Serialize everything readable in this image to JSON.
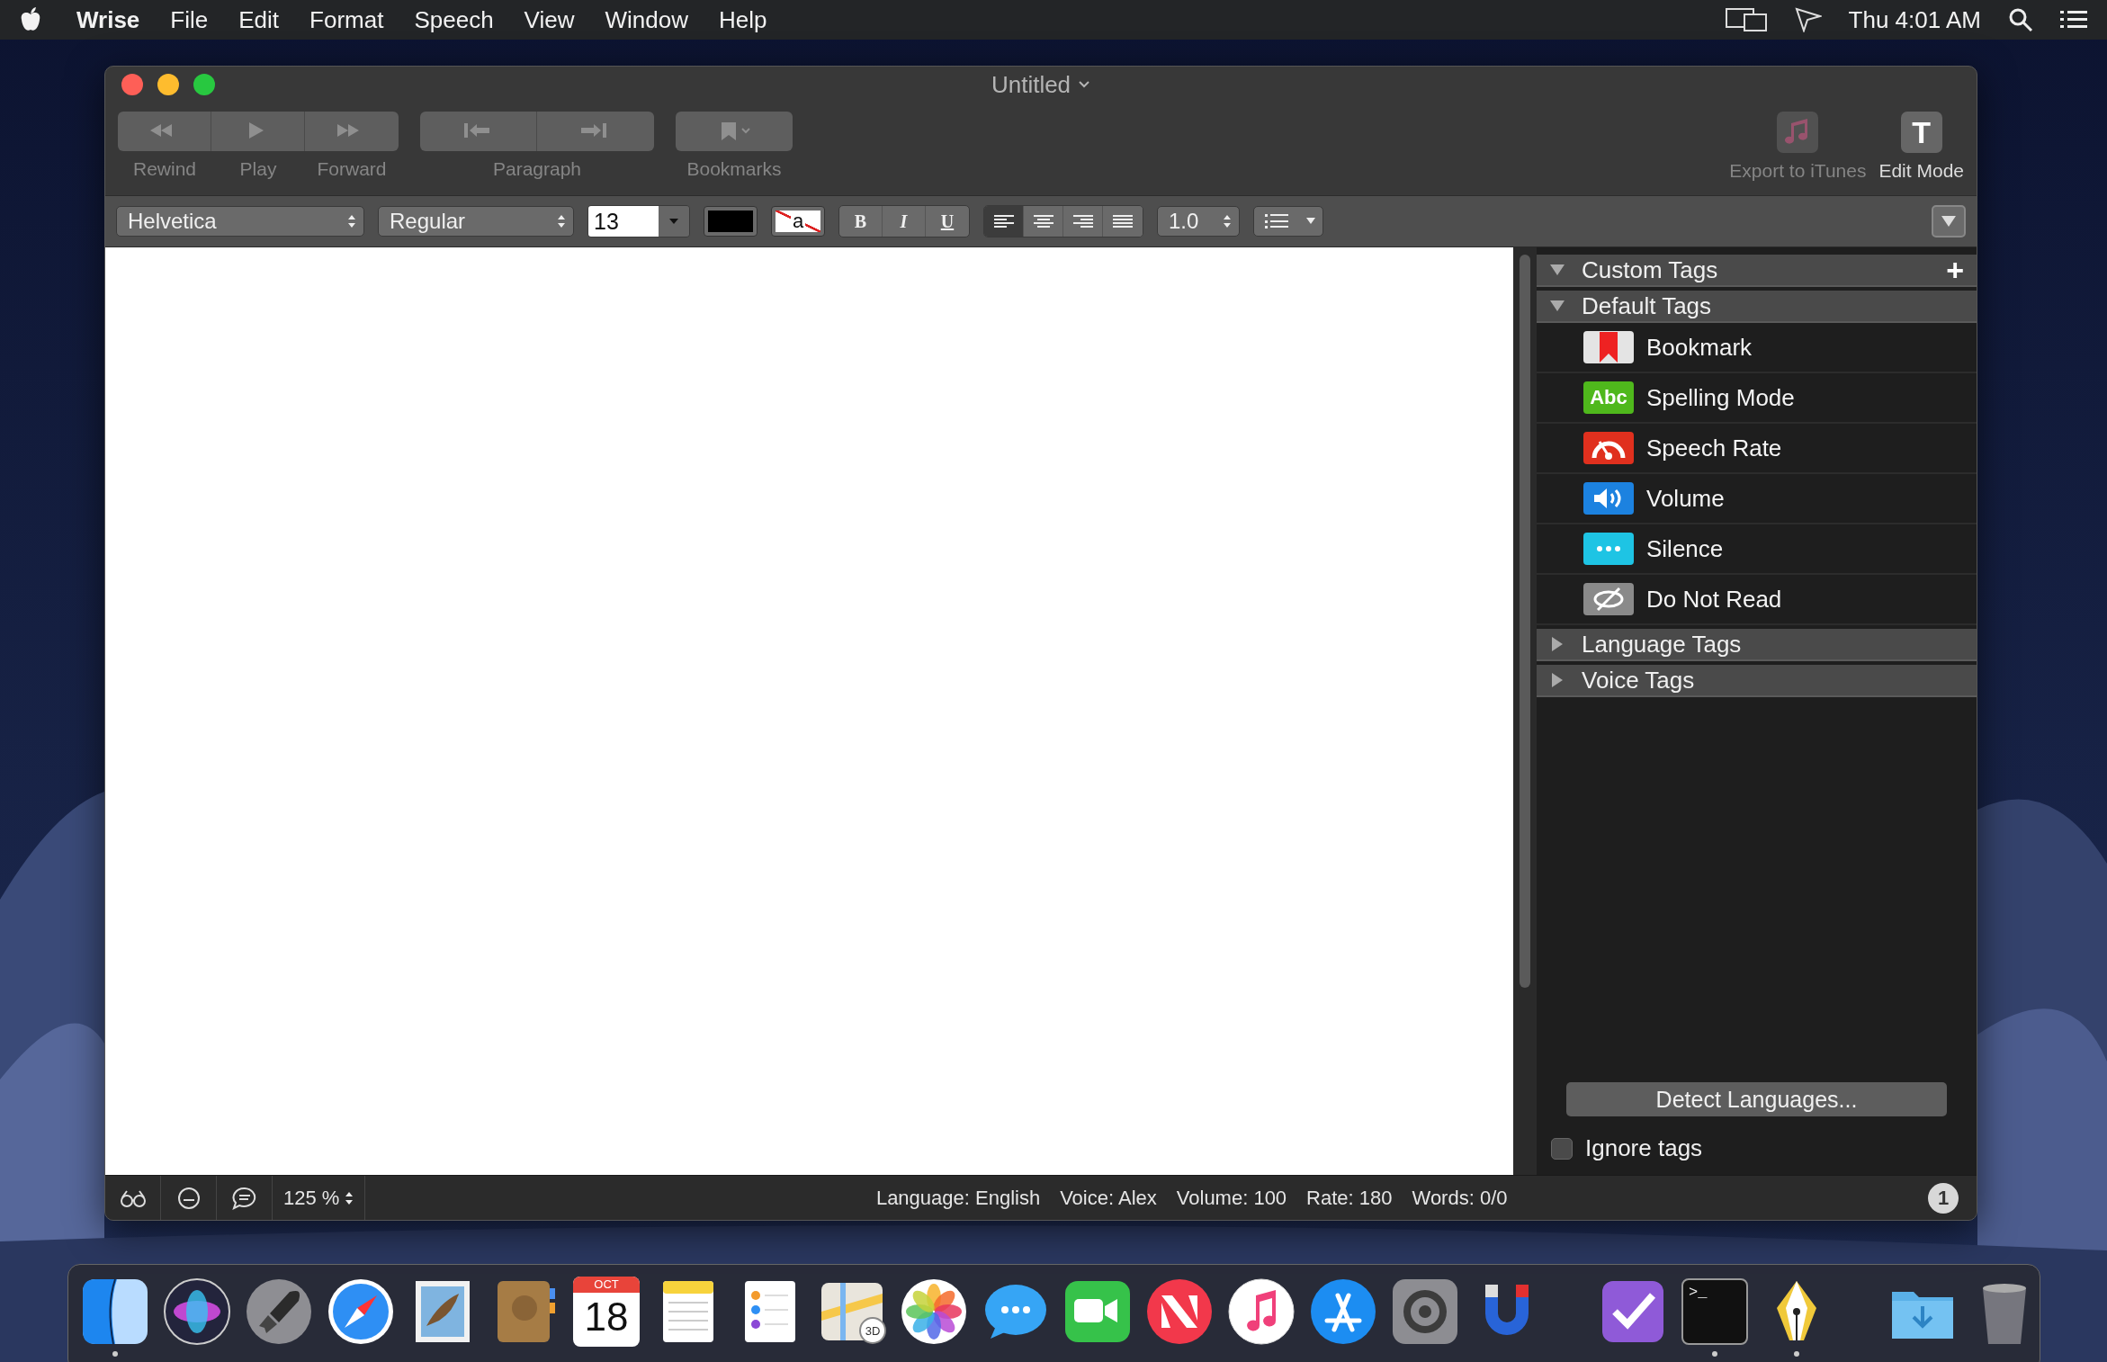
{
  "menubar": {
    "app_name": "Wrise",
    "menus": [
      "File",
      "Edit",
      "Format",
      "Speech",
      "View",
      "Window",
      "Help"
    ],
    "clock": "Thu 4:01 AM"
  },
  "window": {
    "title": "Untitled"
  },
  "toolbar": {
    "groups": [
      {
        "disabled": true,
        "segments": [
          {
            "kind": "rewind",
            "label": "Rewind"
          },
          {
            "kind": "play",
            "label": "Play"
          },
          {
            "kind": "forward",
            "label": "Forward"
          }
        ]
      },
      {
        "disabled": true,
        "label": "Paragraph",
        "segments": [
          {
            "kind": "previous"
          },
          {
            "kind": "next"
          }
        ]
      },
      {
        "disabled": true,
        "label": "Bookmarks",
        "segments": [
          {
            "kind": "bookmarks"
          }
        ]
      }
    ],
    "right_items": [
      {
        "kind": "music",
        "label": "Export to iTunes",
        "disabled": true
      },
      {
        "kind": "letter",
        "letter": "T",
        "label": "Edit Mode",
        "disabled": false
      }
    ]
  },
  "format_bar": {
    "font": "Helvetica",
    "style": "Regular",
    "size": "13",
    "highlight_sample": "a",
    "styles": [
      {
        "kind": "bold",
        "text": "B"
      },
      {
        "kind": "italic",
        "text": "I"
      },
      {
        "kind": "underline",
        "text": "U"
      }
    ],
    "alignment": [
      {
        "kind": "left",
        "selected": true
      },
      {
        "kind": "center",
        "selected": false
      },
      {
        "kind": "right",
        "selected": false
      },
      {
        "kind": "justify",
        "selected": false
      }
    ],
    "line_spacing": "1.0"
  },
  "sidebar": {
    "sections": [
      {
        "title": "Custom Tags",
        "expanded": true,
        "action": "+"
      },
      {
        "title": "Default Tags",
        "expanded": true,
        "children": [
          {
            "kind": "bookmark",
            "label": "Bookmark"
          },
          {
            "kind": "spelling",
            "label": "Spelling Mode",
            "icon_text": "Abc"
          },
          {
            "kind": "rate",
            "label": "Speech Rate"
          },
          {
            "kind": "volume",
            "label": "Volume"
          },
          {
            "kind": "silence",
            "label": "Silence"
          },
          {
            "kind": "skip",
            "label": "Do Not Read"
          }
        ]
      },
      {
        "title": "Language Tags",
        "expanded": false
      },
      {
        "title": "Voice Tags",
        "expanded": false
      }
    ],
    "detect_button": "Detect Languages...",
    "ignore_tags": {
      "label": "Ignore tags",
      "checked": false
    }
  },
  "status_bar": {
    "zoom": "125 %",
    "items": [
      "Language: English",
      "Voice: Alex",
      "Volume: 100",
      "Rate: 180",
      "Words: 0/0"
    ],
    "badge": "1"
  },
  "dock": {
    "sections": [
      [
        {
          "kind": "finder",
          "running": true
        },
        {
          "kind": "siri",
          "running": false
        },
        {
          "kind": "launchpad",
          "running": false
        },
        {
          "kind": "safari",
          "running": false
        },
        {
          "kind": "mail",
          "running": false
        },
        {
          "kind": "contacts",
          "running": false
        },
        {
          "kind": "calendar",
          "month": "OCT",
          "day": "18",
          "running": false
        },
        {
          "kind": "notes",
          "running": false
        },
        {
          "kind": "reminders",
          "running": false
        },
        {
          "kind": "maps",
          "badge": "3D",
          "running": false
        },
        {
          "kind": "photos",
          "running": false
        },
        {
          "kind": "messages",
          "running": false
        },
        {
          "kind": "facetime",
          "running": false
        },
        {
          "kind": "news",
          "running": false
        },
        {
          "kind": "music",
          "running": false
        },
        {
          "kind": "appstore",
          "running": false
        },
        {
          "kind": "settings",
          "running": false
        },
        {
          "kind": "magnet",
          "running": false
        }
      ],
      [
        {
          "kind": "tasks",
          "running": false
        },
        {
          "kind": "terminal",
          "prompt": ">_",
          "running": true
        },
        {
          "kind": "pen",
          "running": true
        }
      ],
      [
        {
          "kind": "downloads",
          "running": false
        },
        {
          "kind": "trash",
          "running": false
        }
      ]
    ]
  }
}
